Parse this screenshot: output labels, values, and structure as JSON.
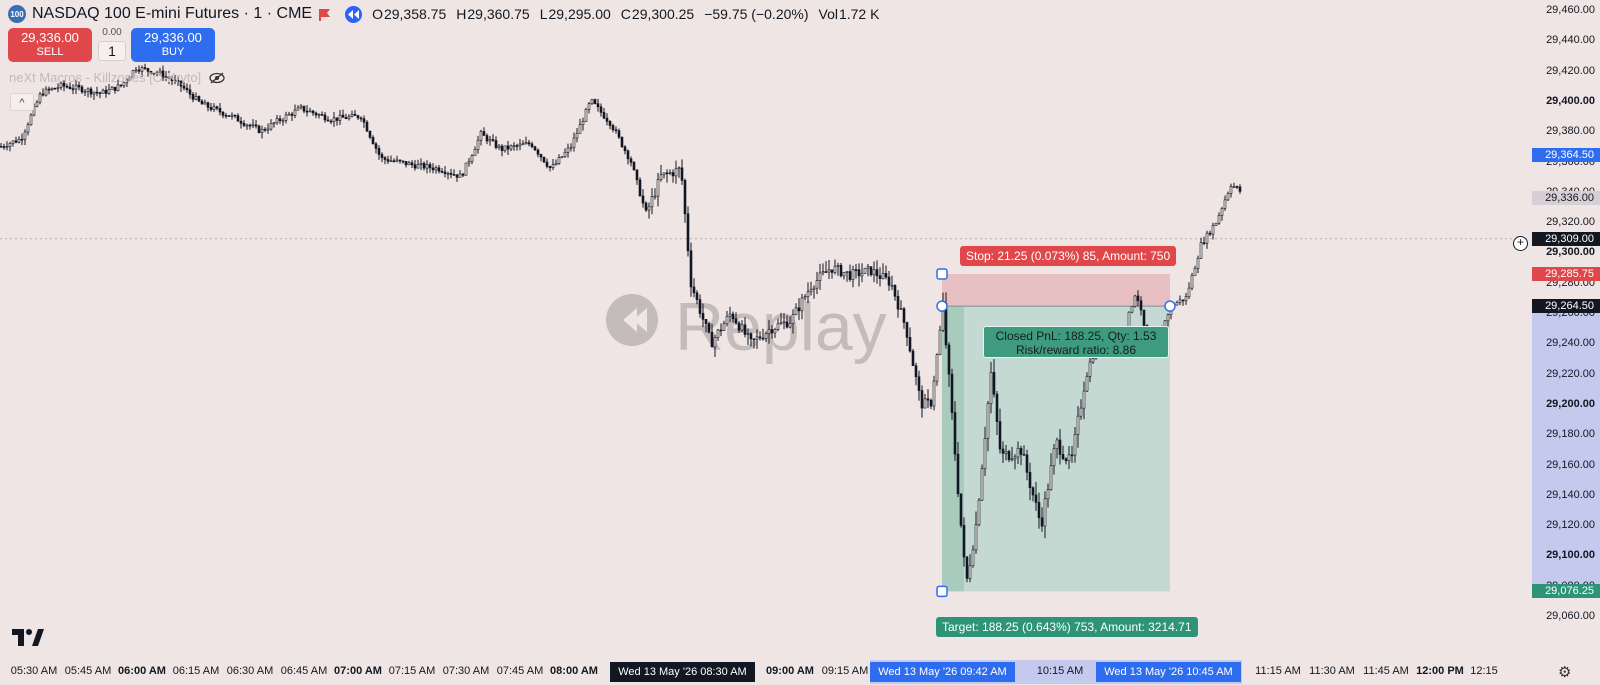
{
  "header": {
    "badge": "100",
    "symbol": "NASDAQ 100 E-mini Futures · 1 · CME",
    "ohlc": {
      "o_label": "O",
      "o": "29,358.75",
      "h_label": "H",
      "h": "29,360.75",
      "l_label": "L",
      "l": "29,295.00",
      "c_label": "C",
      "c": "29,300.25",
      "change": "−59.75 (−0.20%)",
      "vol_label": "Vol",
      "vol": "1.72 K"
    }
  },
  "trade": {
    "sell_price": "29,336.00",
    "sell_label": "SELL",
    "buy_price": "29,336.00",
    "buy_label": "BUY",
    "spread": "0.00",
    "quantity": "1"
  },
  "indicator": {
    "label": "neXt Macros - Killzones [O-Kryto]"
  },
  "watermark": "Replay",
  "position_tool": {
    "stop_label": "Stop: 21.25 (0.073%) 85, Amount: 750",
    "target_label": "Target: 188.25 (0.643%) 753, Amount: 3214.71",
    "pnl_line1": "Closed PnL: 188.25, Qty: 1.53",
    "pnl_line2": "Risk/reward ratio: 8.86"
  },
  "price_axis": {
    "ticks": [
      {
        "p": 29460,
        "label": "29,460.00",
        "bold": false
      },
      {
        "p": 29440,
        "label": "29,440.00",
        "bold": false
      },
      {
        "p": 29420,
        "label": "29,420.00",
        "bold": false
      },
      {
        "p": 29400,
        "label": "29,400.00",
        "bold": true
      },
      {
        "p": 29380,
        "label": "29,380.00",
        "bold": false
      },
      {
        "p": 29360,
        "label": "29,360.00",
        "bold": false
      },
      {
        "p": 29340,
        "label": "29,340.00",
        "bold": false
      },
      {
        "p": 29320,
        "label": "29,320.00",
        "bold": false
      },
      {
        "p": 29300,
        "label": "29,300.00",
        "bold": true
      },
      {
        "p": 29280,
        "label": "29,280.00",
        "bold": false
      },
      {
        "p": 29260,
        "label": "29,260.00",
        "bold": false
      },
      {
        "p": 29240,
        "label": "29,240.00",
        "bold": false
      },
      {
        "p": 29220,
        "label": "29,220.00",
        "bold": false
      },
      {
        "p": 29200,
        "label": "29,200.00",
        "bold": true
      },
      {
        "p": 29180,
        "label": "29,180.00",
        "bold": false
      },
      {
        "p": 29160,
        "label": "29,160.00",
        "bold": false
      },
      {
        "p": 29140,
        "label": "29,140.00",
        "bold": false
      },
      {
        "p": 29120,
        "label": "29,120.00",
        "bold": false
      },
      {
        "p": 29100,
        "label": "29,100.00",
        "bold": true
      },
      {
        "p": 29080,
        "label": "29,080.00",
        "bold": false
      },
      {
        "p": 29060,
        "label": "29,060.00",
        "bold": false
      }
    ],
    "flags": [
      {
        "p": 29364.5,
        "label": "29,364.50",
        "color": "#2f6df0"
      },
      {
        "p": 29336,
        "label": "29,336.00",
        "color": "#d6d0d6"
      },
      {
        "p": 29309,
        "label": "29,309.00",
        "color": "#131722"
      },
      {
        "p": 29285.75,
        "label": "29,285.75",
        "color": "#e0474b"
      },
      {
        "p": 29264.5,
        "label": "29,264.50",
        "color": "#131722"
      },
      {
        "p": 29076.25,
        "label": "29,076.25",
        "color": "#2e9477"
      }
    ]
  },
  "time_axis": {
    "ticks": [
      {
        "label": "05:30 AM",
        "bold": false
      },
      {
        "label": "05:45 AM",
        "bold": false
      },
      {
        "label": "06:00 AM",
        "bold": true
      },
      {
        "label": "06:15 AM",
        "bold": false
      },
      {
        "label": "06:30 AM",
        "bold": false
      },
      {
        "label": "06:45 AM",
        "bold": false
      },
      {
        "label": "07:00 AM",
        "bold": true
      },
      {
        "label": "07:15 AM",
        "bold": false
      },
      {
        "label": "07:30 AM",
        "bold": false
      },
      {
        "label": "07:45 AM",
        "bold": false
      },
      {
        "label": "08:00 AM",
        "bold": true
      },
      {
        "label": "09:00 AM",
        "bold": true
      },
      {
        "label": "09:15 AM",
        "bold": false
      },
      {
        "label": "10:15 AM",
        "bold": false
      },
      {
        "label": "11:15 AM",
        "bold": false
      },
      {
        "label": "11:30 AM",
        "bold": false
      },
      {
        "label": "11:45 AM",
        "bold": false
      },
      {
        "label": "12:00 PM",
        "bold": true
      },
      {
        "label": "12:15",
        "bold": false
      }
    ],
    "cursor_label": "Wed 13 May '26   08:30 AM",
    "entry_label": "Wed 13 May '26   09:42 AM",
    "exit_label": "Wed 13 May '26   10:45 AM"
  },
  "colors": {
    "background": "#efe5e4",
    "stop_zone": "#e8bfc3",
    "target_zone": "#c4d9d1",
    "sell": "#e0474b",
    "buy": "#2f6df0",
    "target": "#2e9477"
  }
}
